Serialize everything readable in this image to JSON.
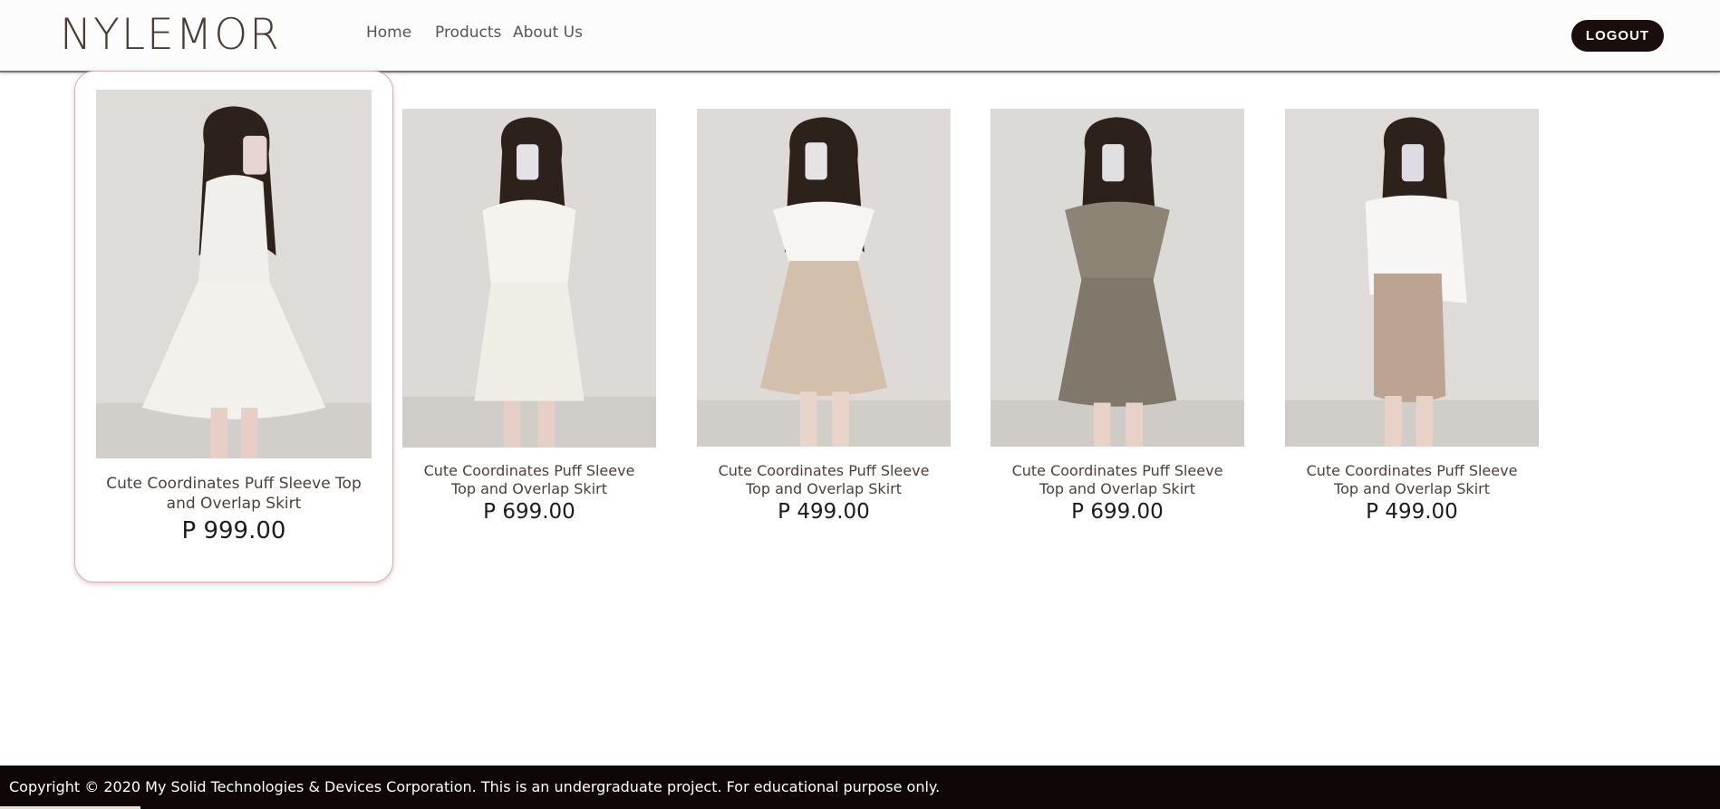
{
  "header": {
    "brand": "NYLEMOR",
    "nav": [
      {
        "label": "Home"
      },
      {
        "label": "Products"
      },
      {
        "label": "About Us"
      }
    ],
    "logout_label": "LOGOUT"
  },
  "products": [
    {
      "name": "Cute Coordinates Puff Sleeve Top and Overlap Skirt",
      "price": "P 999.00",
      "top_color": "#f1efec",
      "skirt_color": "#f3f1ec",
      "featured": true
    },
    {
      "name": "Cute Coordinates Puff Sleeve Top and Overlap Skirt",
      "price": "P 699.00",
      "top_color": "#f5f3ee",
      "skirt_color": "#f0ede6",
      "featured": false
    },
    {
      "name": "Cute Coordinates Puff Sleeve Top and Overlap Skirt",
      "price": "P 499.00",
      "top_color": "#f6f5f2",
      "skirt_color": "#d3c0ac",
      "featured": false
    },
    {
      "name": "Cute Coordinates Puff Sleeve Top and Overlap Skirt",
      "price": "P 699.00",
      "top_color": "#8c8475",
      "skirt_color": "#7f786b",
      "featured": false
    },
    {
      "name": "Cute Coordinates Puff Sleeve Top and Overlap Skirt",
      "price": "P 499.00",
      "top_color": "#f7f6f4",
      "skirt_color": "#bca392",
      "featured": false
    }
  ],
  "footer": {
    "copyright": "Copyright © 2020 My Solid Technologies & Devices Corporation. This is an undergraduate project. For educational purpose only."
  }
}
